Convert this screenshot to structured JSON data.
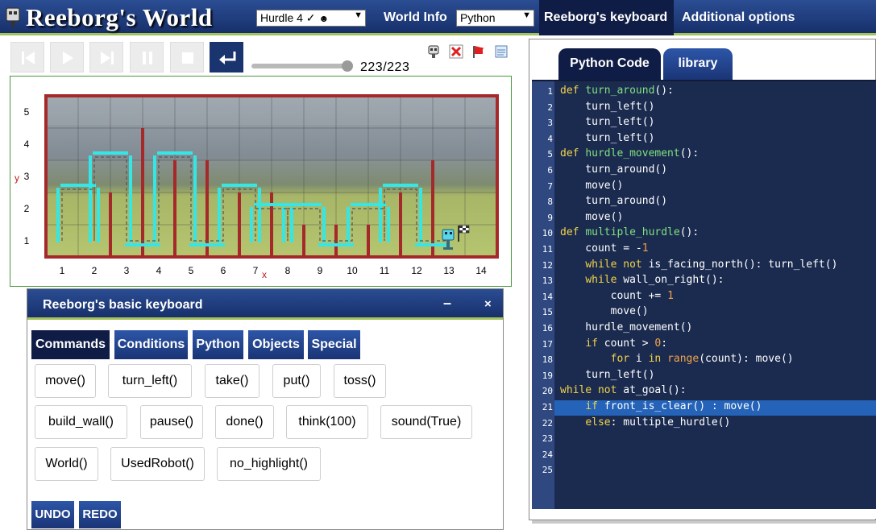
{
  "app": {
    "title": "Reeborg's World"
  },
  "header": {
    "world_select": "Hurdle 4 ✓",
    "world_info": "World Info",
    "language_select": "Python",
    "keyboard_tab": "Reeborg's keyboard",
    "options_tab": "Additional options"
  },
  "controls": {
    "step_counter": "223/223",
    "step_progress": 1.0
  },
  "world": {
    "x_labels": [
      "1",
      "2",
      "3",
      "4",
      "5",
      "6",
      "7",
      "8",
      "9",
      "10",
      "11",
      "12",
      "13",
      "14"
    ],
    "y_labels": [
      "1",
      "2",
      "3",
      "4",
      "5"
    ],
    "x_axis_letter": "x",
    "y_axis_letter": "y",
    "colors": {
      "wall": "#a5282a",
      "trace": "#35e6e6",
      "path": "#555555"
    }
  },
  "code_panel": {
    "tabs": [
      "Python Code",
      "library"
    ],
    "active_tab": "Python Code",
    "highlighted_line": 21,
    "line_numbers": [
      "1",
      "2",
      "3",
      "4",
      "5",
      "6",
      "7",
      "8",
      "9",
      "10",
      "11",
      "12",
      "13",
      "14",
      "15",
      "16",
      "17",
      "18",
      "19",
      "20",
      "21",
      "22",
      "23",
      "24",
      "25"
    ],
    "lines": [
      "def turn_around():",
      "    turn_left()",
      "    turn_left()",
      "    turn_left()",
      "def hurdle_movement():",
      "    turn_around()",
      "    move()",
      "    turn_around()",
      "    move()",
      "def multiple_hurdle():",
      "    count = -1",
      "    while not is_facing_north(): turn_left()",
      "    while wall_on_right():",
      "        count += 1",
      "        move()",
      "    hurdle_movement()",
      "    if count > 0:",
      "        for i in range(count): move()",
      "    turn_left()",
      "while not at_goal():",
      "    if front_is_clear() : move()",
      "    else: multiple_hurdle()",
      "",
      "",
      ""
    ]
  },
  "keyboard": {
    "title": "Reeborg's basic keyboard",
    "minimize": "–",
    "close": "×",
    "tabs": [
      "Commands",
      "Conditions",
      "Python",
      "Objects",
      "Special"
    ],
    "active_tab": "Commands",
    "buttons": [
      "move()",
      "turn_left()",
      "take()",
      "put()",
      "toss()",
      "build_wall()",
      "pause()",
      "done()",
      "think(100)",
      "sound(True)",
      "World()",
      "UsedRobot()",
      "no_highlight()"
    ],
    "undo": "UNDO",
    "redo": "REDO"
  }
}
